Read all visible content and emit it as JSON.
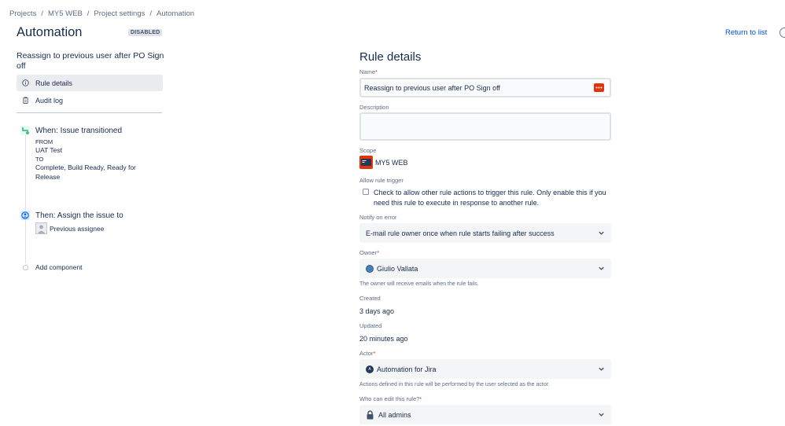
{
  "breadcrumb": {
    "items": [
      "Projects",
      "MY5 WEB",
      "Project settings",
      "Automation"
    ],
    "separator": "/"
  },
  "header": {
    "title": "Automation",
    "status_badge": "DISABLED",
    "return_link": "Return to list"
  },
  "sidebar": {
    "rule_name": "Reassign to previous user after PO Sign off",
    "nav": [
      {
        "label": "Rule details",
        "icon": "info-icon",
        "active": true
      },
      {
        "label": "Audit log",
        "icon": "clipboard-icon",
        "active": false
      }
    ],
    "trigger": {
      "title": "When: Issue transitioned",
      "from_label": "FROM",
      "from_value": "UAT Test",
      "to_label": "TO",
      "to_value": "Complete, Build Ready, Ready for Release",
      "icon": "transition-icon"
    },
    "action": {
      "title": "Then: Assign the issue to",
      "value": "Previous assignee",
      "icon": "assign-icon"
    },
    "add_component": "Add component"
  },
  "details": {
    "title": "Rule details",
    "name": {
      "label": "Name",
      "required": "*",
      "value": "Reassign to previous user after PO Sign off"
    },
    "description": {
      "label": "Description",
      "value": ""
    },
    "scope": {
      "label": "Scope",
      "value": "MY5 WEB"
    },
    "allow_trigger": {
      "label": "Allow rule trigger",
      "text_line1": "Check to allow other rule actions to trigger this rule. Only enable this if you",
      "text_line2": "need this rule to execute in response to another rule.",
      "checked": false
    },
    "notify": {
      "label": "Notify on error",
      "value": "E-mail rule owner once when rule starts failing after success"
    },
    "owner": {
      "label": "Owner",
      "required": "*",
      "value": "Giulio Vallata",
      "help": "The owner will receive emails when the rule fails."
    },
    "created": {
      "label": "Created",
      "value": "3 days ago"
    },
    "updated": {
      "label": "Updated",
      "value": "20 minutes ago"
    },
    "actor": {
      "label": "Actor",
      "required": "*",
      "value": "Automation for Jira",
      "help": "Actions defined in this rule will be performed by the user selected as the actor."
    },
    "editors": {
      "label": "Who can edit this rule?",
      "required": "*",
      "value": "All admins"
    }
  },
  "colors": {
    "accent": "#0052cc",
    "trigger_green": "#36b37e",
    "action_blue": "#0065ff",
    "badge_bg": "#dfe1e6",
    "field_bg": "#f4f5f7",
    "error_icon": "#de350b"
  }
}
